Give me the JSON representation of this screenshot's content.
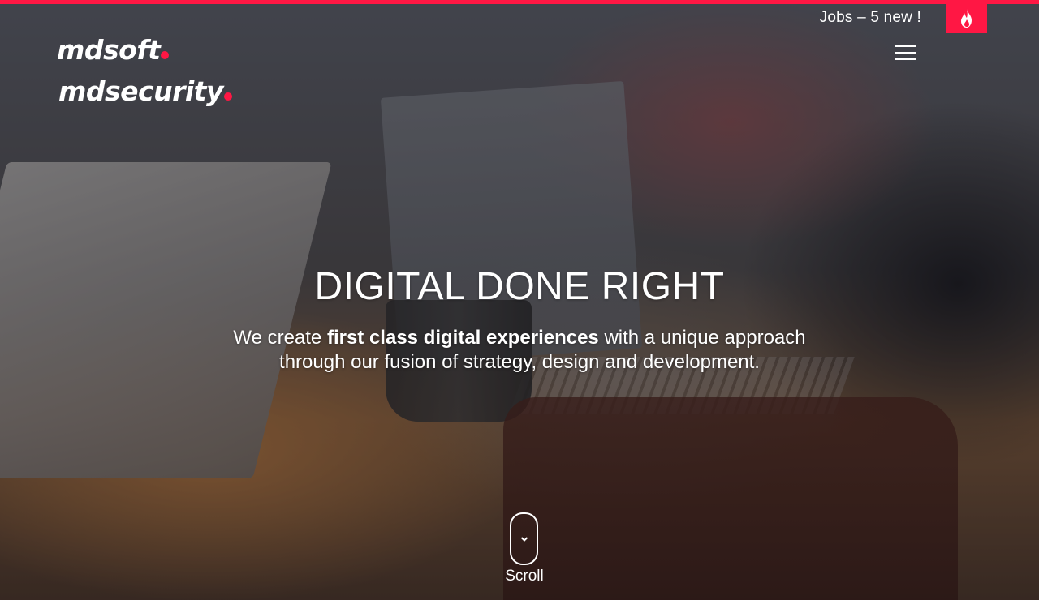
{
  "header": {
    "jobs_link": "Jobs – 5 new !",
    "fire_icon": "fire-icon",
    "menu_icon": "hamburger-menu-icon"
  },
  "logos": {
    "mdsoft": "mdsoft",
    "mdsecurity": "mdsecurity"
  },
  "hero": {
    "title": "DIGITAL DONE RIGHT",
    "subtitle_pre": "We create ",
    "subtitle_bold": "first class digital experiences",
    "subtitle_post": " with a unique approach",
    "subtitle_line2": "through our fusion of strategy, design and development."
  },
  "scroll": {
    "label": "Scroll",
    "icon": "chevron-down-icon"
  },
  "colors": {
    "accent": "#ff1744",
    "text": "#ffffff"
  }
}
